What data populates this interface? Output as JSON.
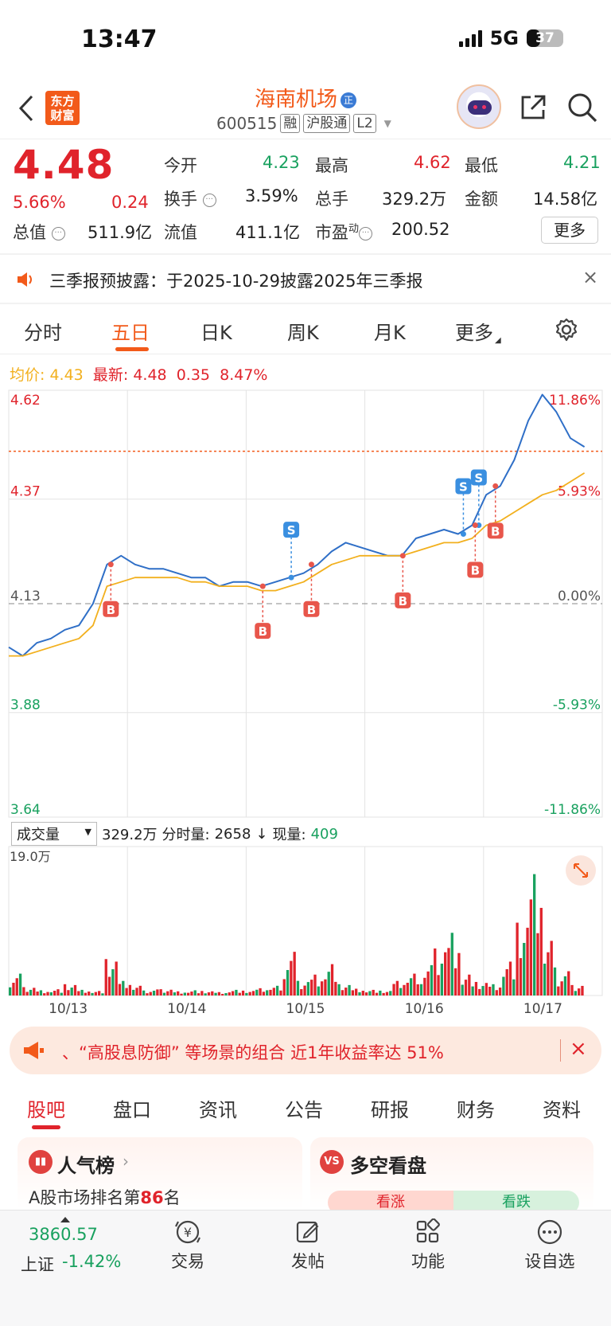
{
  "status_bar": {
    "time": "13:47",
    "network": "5G",
    "battery": "37",
    "battery_level": 0.37
  },
  "header": {
    "logo_text": "东方\n财富",
    "stock_name": "海南机场",
    "badge": "正",
    "code": "600515",
    "tags": [
      "融",
      "沪股通",
      "L2"
    ]
  },
  "quote": {
    "price": "4.48",
    "change_pct": "5.66%",
    "change_abs": "0.24",
    "open_label": "今开",
    "open": "4.23",
    "high_label": "最高",
    "high": "4.62",
    "low_label": "最低",
    "low": "4.21",
    "turnover_label": "换手",
    "turnover": "3.59%",
    "volume_label": "总手",
    "volume": "329.2万",
    "amount_label": "金额",
    "amount": "14.58亿",
    "mcap_label": "总值",
    "mcap": "511.9亿",
    "float_label": "流值",
    "float": "411.1亿",
    "pe_label": "市盈",
    "pe_sup": "动",
    "pe": "200.52",
    "more_button": "更多"
  },
  "notice": {
    "text": "三季报预披露：于2025-10-29披露2025年三季报",
    "close": "×"
  },
  "chart_tabs": [
    "分时",
    "五日",
    "日K",
    "周K",
    "月K",
    "更多"
  ],
  "active_chart_tab": 1,
  "legend": {
    "avg_label": "均价:",
    "avg": "4.43",
    "latest_label": "最新:",
    "latest": "4.48",
    "change": "0.35",
    "pct": "8.47%"
  },
  "volume_header": {
    "selector": "成交量",
    "total": "329.2万",
    "minute_label": "分时量:",
    "minute": "2658",
    "arrow": "↓",
    "now_label": "现量:",
    "now": "409"
  },
  "chart_data": {
    "type": "line",
    "x": [
      "10/13",
      "10/14",
      "10/15",
      "10/16",
      "10/17"
    ],
    "y_ticks_left": [
      "4.62",
      "4.37",
      "4.13",
      "3.88",
      "3.64"
    ],
    "y_ticks_right": [
      "11.86%",
      "5.93%",
      "0.00%",
      "-5.93%",
      "-11.86%"
    ],
    "ylim": [
      3.64,
      4.62
    ],
    "prev_close": 4.13,
    "latest_price": 4.48,
    "series": [
      {
        "name": "价格",
        "values": [
          4.03,
          4.01,
          4.04,
          4.05,
          4.07,
          4.08,
          4.13,
          4.22,
          4.24,
          4.22,
          4.21,
          4.21,
          4.2,
          4.19,
          4.19,
          4.17,
          4.18,
          4.18,
          4.17,
          4.18,
          4.19,
          4.2,
          4.22,
          4.25,
          4.27,
          4.26,
          4.25,
          4.24,
          4.24,
          4.28,
          4.29,
          4.3,
          4.29,
          4.31,
          4.38,
          4.4,
          4.46,
          4.55,
          4.61,
          4.57,
          4.51,
          4.49
        ]
      },
      {
        "name": "均价",
        "values": [
          4.01,
          4.01,
          4.02,
          4.03,
          4.04,
          4.05,
          4.08,
          4.17,
          4.18,
          4.19,
          4.19,
          4.19,
          4.19,
          4.18,
          4.18,
          4.17,
          4.17,
          4.17,
          4.16,
          4.16,
          4.17,
          4.18,
          4.2,
          4.22,
          4.23,
          4.24,
          4.24,
          4.24,
          4.24,
          4.25,
          4.26,
          4.27,
          4.27,
          4.28,
          4.31,
          4.32,
          4.34,
          4.36,
          4.38,
          4.39,
          4.41,
          4.43
        ]
      }
    ],
    "markers": [
      {
        "type": "B",
        "day": 0.86
      },
      {
        "type": "B",
        "day": 2.14
      },
      {
        "type": "S",
        "day": 2.38
      },
      {
        "type": "B",
        "day": 2.55
      },
      {
        "type": "B",
        "day": 3.32
      },
      {
        "type": "S",
        "day": 3.83
      },
      {
        "type": "S",
        "day": 3.96
      },
      {
        "type": "B",
        "day": 3.93
      },
      {
        "type": "B",
        "day": 4.1
      }
    ],
    "volume": {
      "ylabel": "19.0万",
      "bars": [
        0.18,
        0.08,
        0.05,
        0.06,
        0.1,
        0.05,
        0.04,
        0.3,
        0.12,
        0.08,
        0.05,
        0.06,
        0.04,
        0.05,
        0.04,
        0.03,
        0.05,
        0.04,
        0.06,
        0.08,
        0.36,
        0.14,
        0.2,
        0.3,
        0.1,
        0.06,
        0.05,
        0.04,
        0.12,
        0.18,
        0.25,
        0.45,
        0.6,
        0.2,
        0.12,
        0.1,
        0.3,
        0.6,
        1.0,
        0.45,
        0.2,
        0.1
      ]
    }
  },
  "ad": {
    "text": "、“高股息防御” 等场景的组合 近1年收益率达 51%",
    "close": "×"
  },
  "section_tabs": [
    "股吧",
    "盘口",
    "资讯",
    "公告",
    "研报",
    "财务",
    "资料"
  ],
  "cards": {
    "hot_title": "人气榜",
    "hot_rank_prefix": "A股市场排名第",
    "hot_rank": "86",
    "hot_rank_suffix": "名",
    "duokong_title": "多空看盘",
    "duokong_badge": "VS",
    "up": "看涨",
    "down": "看跌"
  },
  "bottom_nav": {
    "index_value": "3860.57",
    "index_name": "上证",
    "index_change": "-1.42%",
    "items": [
      "交易",
      "发帖",
      "功能",
      "设自选"
    ]
  },
  "colors": {
    "brand": "#f25a1a",
    "up": "#e0232b",
    "down": "#19a15f",
    "price_line": "#2f6fc7",
    "avg_line": "#f2b01e"
  }
}
